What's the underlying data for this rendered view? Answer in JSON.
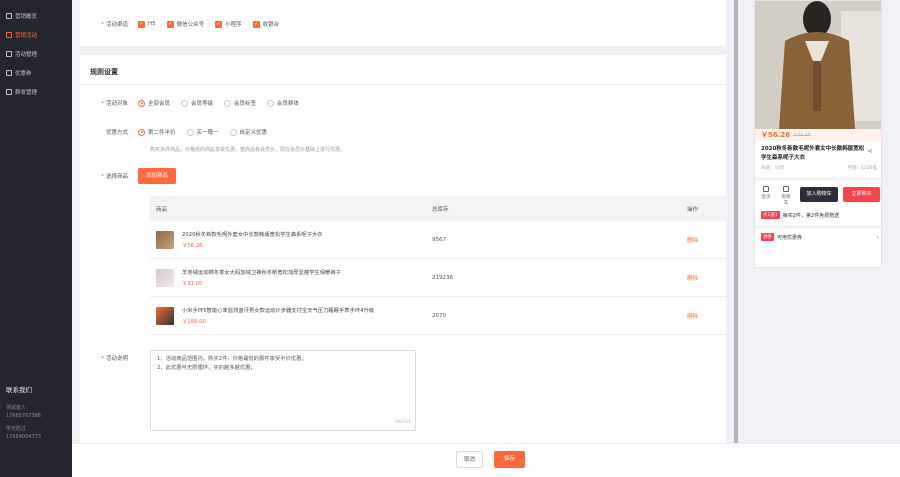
{
  "sidebar": {
    "items": [
      {
        "label": "营销概览",
        "active": false
      },
      {
        "label": "营销活动",
        "active": true
      },
      {
        "label": "活动管理",
        "active": false
      },
      {
        "label": "优惠券",
        "active": false
      },
      {
        "label": "群发管理",
        "active": false
      }
    ],
    "contact": {
      "title": "联系我们",
      "rows": [
        {
          "label": "测试客人",
          "value": "17685767386"
        },
        {
          "label": "学无胜过",
          "value": "17664004773"
        }
      ]
    }
  },
  "channels": {
    "label": "活动渠道",
    "options": [
      "H5",
      "微信公众号",
      "小程序",
      "收银台"
    ]
  },
  "rules": {
    "title": "规则设置",
    "target": {
      "label": "活动对象",
      "options": [
        "全部会员",
        "会员等级",
        "会员标签",
        "会员群体"
      ],
      "selected_index": 0
    },
    "discount": {
      "label": "优惠方式",
      "options": [
        "第二件半价",
        "买一赠一",
        "自定义优惠"
      ],
      "selected_index": 0,
      "hint": "购买多件商品，价格低的商品享受优惠，若商品有会员价，则在会员价基础上进行优惠。"
    },
    "products": {
      "label": "选择商品",
      "add_button": "添加商品",
      "columns": [
        "商品",
        "总库存",
        "操作"
      ],
      "rows": [
        {
          "name": "2020秋冬新款毛呢外套女中长款韩版宽松学生森系呢子大衣",
          "price": "￥56.26",
          "stock": "9567",
          "op": "删除"
        },
        {
          "name": "羊羔绒运动棉冬季女大码加绒卫裤秋冬新宽松加厚显瘦学生保暖裤子",
          "price": "￥31.00",
          "stock": "219236",
          "op": "删除"
        },
        {
          "name": "小米手环5智能心率监测蓝牙男女款运动计步器支付宝天气压力睡眠手表手环4升级",
          "price": "￥189.00",
          "stock": "2070",
          "op": "删除"
        }
      ]
    },
    "description": {
      "label": "活动说明",
      "lines": [
        "1、活动商品范围内，购买2件，价格最低的那件享受半价优惠；",
        "2、此优惠可无限循环，买的越多越优惠；"
      ],
      "counter": "48/200"
    }
  },
  "footer": {
    "cancel": "取消",
    "save": "保存"
  },
  "preview": {
    "price": "￥56.26",
    "old_price": "￥56.26",
    "title": "2020秋冬新款毛呢外套女中长款韩版宽松学生森系呢子大衣",
    "shipping": "快递：10元",
    "stock": "月销：1220笔",
    "tab_home": "首页",
    "tab_cart": "购物车",
    "add_cart": "加入购物车",
    "buy_now": "立即购买",
    "promo_tag": "买1送1",
    "promo_text": "每买2件，第2件免费赠送",
    "coupon_tag": "领券",
    "coupon_text": "可用优惠券"
  },
  "colors": {
    "accent": "#ff6a3c",
    "sidebar_bg": "#23262e",
    "buy": "#f5434e"
  }
}
